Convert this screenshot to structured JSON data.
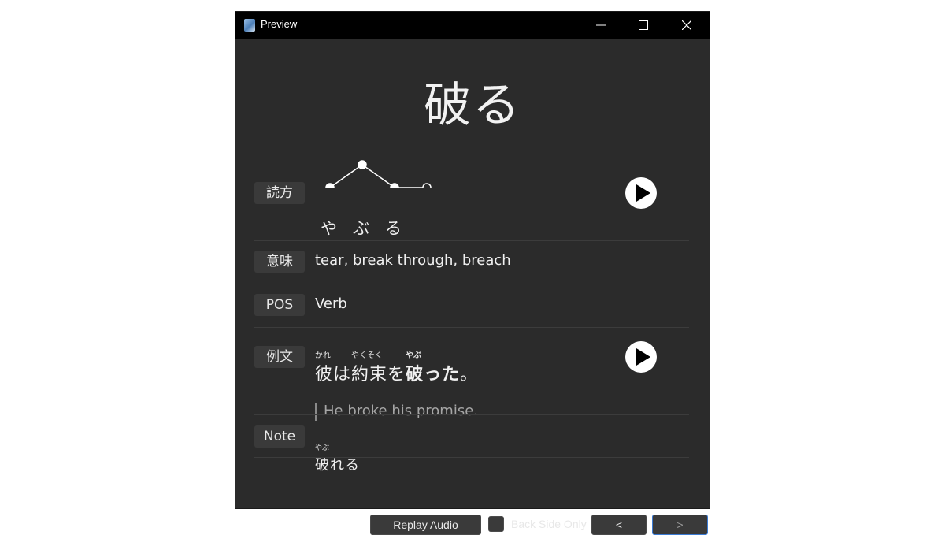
{
  "window": {
    "title": "Preview"
  },
  "card": {
    "headword": "破る",
    "reading": {
      "label": "読方",
      "kana": [
        "や",
        "ぶ",
        "る"
      ],
      "pitch": [
        0,
        1,
        0,
        0
      ]
    },
    "meaning": {
      "label": "意味",
      "value": "tear, break through, breach"
    },
    "pos": {
      "label": "POS",
      "value": "Verb"
    },
    "example": {
      "label": "例文",
      "segments": [
        {
          "text": "彼",
          "furigana": "かれ",
          "bold": false
        },
        {
          "text": "は",
          "furigana": "",
          "bold": false
        },
        {
          "text": "約束",
          "furigana": "やくそく",
          "bold": false
        },
        {
          "text": "を",
          "furigana": "",
          "bold": false
        },
        {
          "text": "破",
          "furigana": "やぶ",
          "bold": true
        },
        {
          "text": "った",
          "furigana": "",
          "bold": true
        },
        {
          "text": "。",
          "furigana": "",
          "bold": false
        }
      ],
      "translation": "He broke his promise."
    },
    "note": {
      "label": "Note",
      "segments": [
        {
          "text": "破",
          "furigana": "やぶ"
        },
        {
          "text": "れる",
          "furigana": ""
        }
      ]
    }
  },
  "footer": {
    "replay_label": "Replay Audio",
    "back_side_label": "Back Side Only",
    "back_side_checked": false,
    "prev_label": "<",
    "next_label": ">"
  },
  "icons": {
    "app": "app-icon",
    "minimize": "minimize-icon",
    "maximize": "maximize-icon",
    "close": "close-icon",
    "play": "play-icon"
  },
  "colors": {
    "background": "#2b2b2b",
    "titlebar": "#000000",
    "label_bg": "#3a3a3a",
    "text": "#f0f0f0",
    "translation": "#a6a6a6",
    "next_border": "#3b7bd4"
  }
}
